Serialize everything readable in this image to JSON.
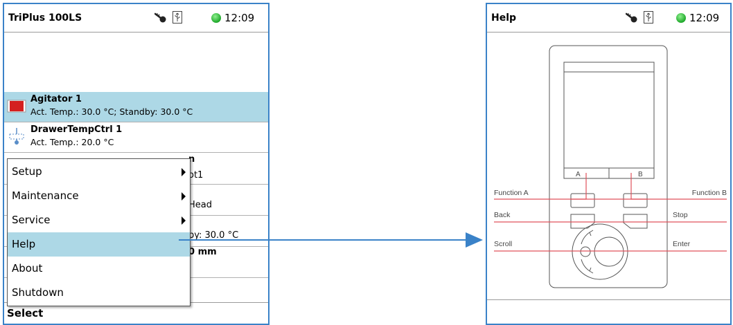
{
  "left_screen": {
    "status": {
      "title": "TriPlus 100LS",
      "time": "12:09",
      "status_color": "#1ea82a"
    },
    "rows": [
      {
        "name": "Agitator 1",
        "detail": "Act. Temp.: 30.0 °C; Standby: 30.0 °C",
        "selected": true
      },
      {
        "name": "DrawerTempCtrl 1",
        "detail": "Act. Temp.: 20.0 °C",
        "selected": false
      }
    ],
    "partial_fragments": {
      "frag1": "n",
      "frag2": "ot1",
      "frag3": "Head",
      "frag4": "by: 30.0 °C",
      "frag5": "0 mm"
    },
    "menu": {
      "items": [
        {
          "label": "Setup",
          "submenu": true
        },
        {
          "label": "Maintenance",
          "submenu": true
        },
        {
          "label": "Service",
          "submenu": true
        },
        {
          "label": "Help",
          "submenu": false,
          "active": true
        },
        {
          "label": "About",
          "submenu": false
        },
        {
          "label": "Shutdown",
          "submenu": false
        }
      ]
    },
    "bottom_label": "Select"
  },
  "right_screen": {
    "status": {
      "title": "Help",
      "time": "12:09",
      "status_color": "#1ea82a"
    },
    "figure": {
      "key_a": "A",
      "key_b": "B",
      "labels": {
        "function_a": "Function A",
        "function_b": "Function B",
        "back": "Back",
        "stop": "Stop",
        "scroll": "Scroll",
        "enter": "Enter"
      }
    }
  },
  "colors": {
    "screen_border": "#3a82c8",
    "selection": "#add8e6",
    "callout_line": "#e0505a",
    "connector": "#3a82c8"
  }
}
